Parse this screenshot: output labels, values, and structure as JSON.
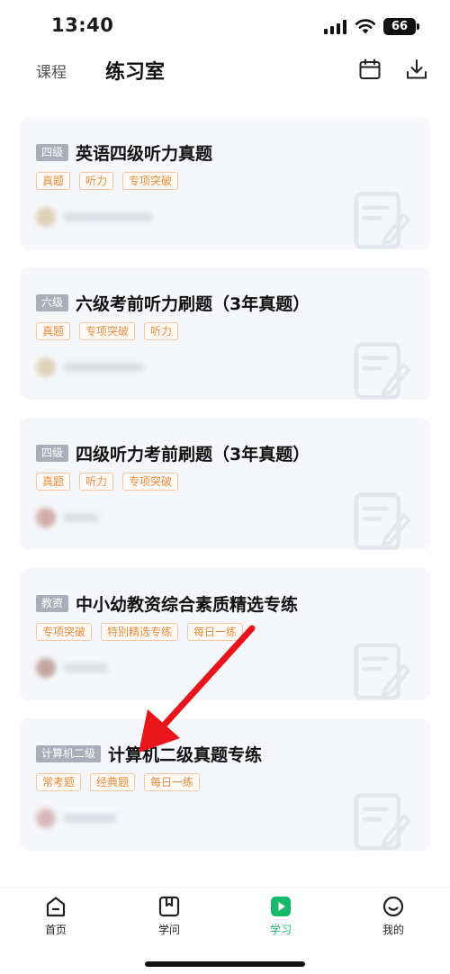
{
  "status_bar": {
    "time": "13:40",
    "battery": "66"
  },
  "header": {
    "tab_course": "课程",
    "tab_practice": "练习室",
    "calendar_icon": "calendar-icon",
    "download_icon": "download-icon"
  },
  "cards": [
    {
      "level": "四级",
      "title": "英语四级听力真题",
      "tags": [
        "真题",
        "听力",
        "专项突破"
      ]
    },
    {
      "level": "六级",
      "title": "六级考前听力刷题（3年真题）",
      "tags": [
        "真题",
        "专项突破",
        "听力"
      ]
    },
    {
      "level": "四级",
      "title": "四级听力考前刷题（3年真题）",
      "tags": [
        "真题",
        "听力",
        "专项突破"
      ]
    },
    {
      "level": "教资",
      "title": "中小幼教资综合素质精选专练",
      "tags": [
        "专项突破",
        "特别精选专练",
        "每日一练"
      ]
    },
    {
      "level": "计算机二级",
      "title": "计算机二级真题专练",
      "tags": [
        "常考题",
        "经典题",
        "每日一练"
      ]
    }
  ],
  "tabbar": {
    "items": [
      {
        "label": "首页",
        "icon": "home-icon"
      },
      {
        "label": "学问",
        "icon": "book-icon"
      },
      {
        "label": "学习",
        "icon": "play-icon"
      },
      {
        "label": "我的",
        "icon": "smile-icon"
      }
    ],
    "active_index": 2
  },
  "colors": {
    "accent": "#19b96b",
    "tag_text": "#e58d3f",
    "badge_bg": "#a9aeb8",
    "arrow": "#e8161b"
  }
}
